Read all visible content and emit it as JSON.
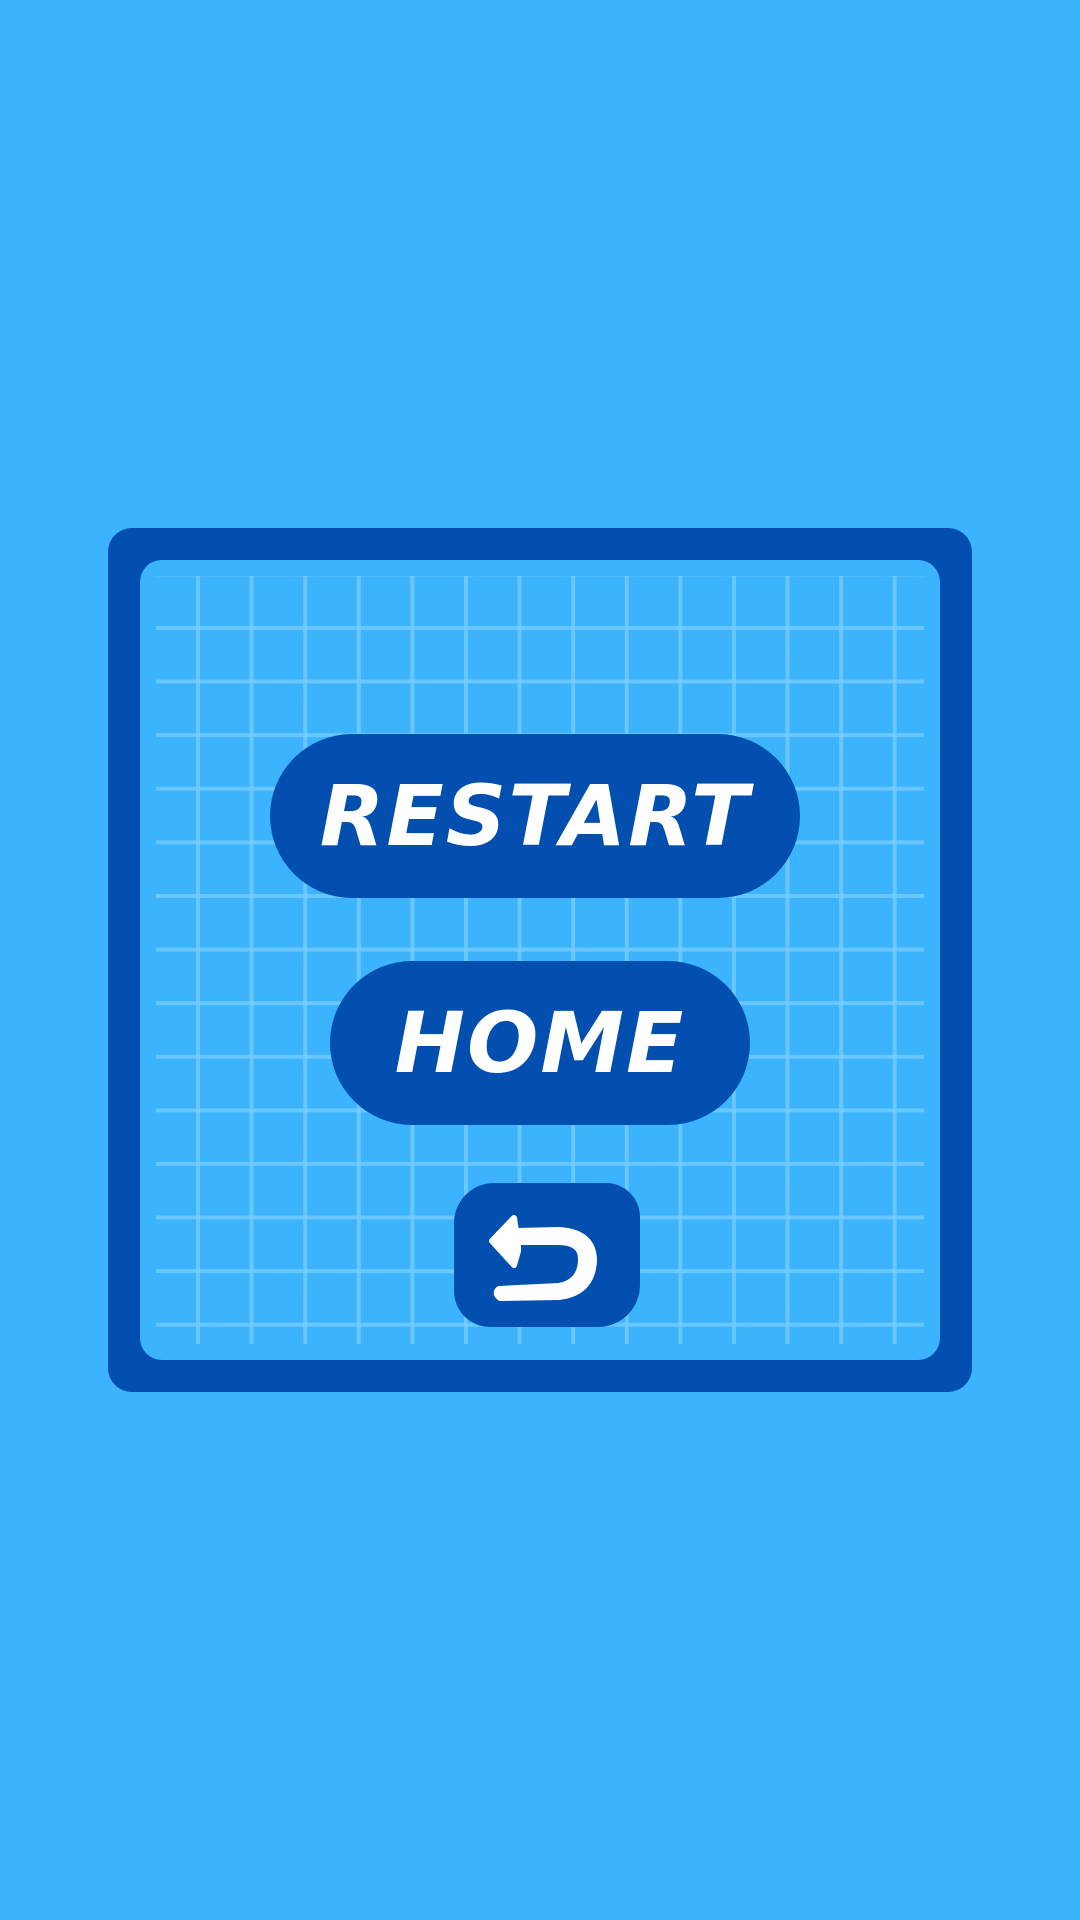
{
  "colors": {
    "background": "#3bb4fd",
    "panel": "#034fb0",
    "grid_line": "#78cdff",
    "button": "#034fb0",
    "button_text": "#ffffff"
  },
  "menu": {
    "restart_label": "RESTART",
    "home_label": "HOME",
    "back_icon": "undo-arrow-icon"
  }
}
